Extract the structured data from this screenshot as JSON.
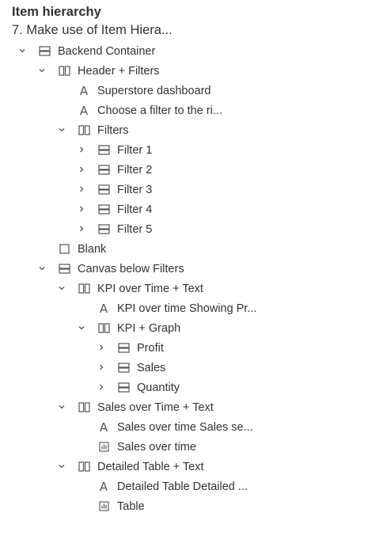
{
  "panel": {
    "title": "Item hierarchy",
    "dashboard_name": "7. Make use of Item Hiera..."
  },
  "tree": [
    {
      "label": "Backend Container",
      "type": "vertical",
      "toggle": "expanded"
    },
    {
      "label": "Header + Filters",
      "type": "horizontal",
      "toggle": "expanded"
    },
    {
      "label": "Superstore dashboard",
      "type": "text",
      "toggle": "none"
    },
    {
      "label": "Choose a filter to the ri...",
      "type": "text",
      "toggle": "none"
    },
    {
      "label": "Filters",
      "type": "horizontal",
      "toggle": "expanded"
    },
    {
      "label": "Filter 1",
      "type": "vertical",
      "toggle": "collapsed"
    },
    {
      "label": "Filter 2",
      "type": "vertical",
      "toggle": "collapsed"
    },
    {
      "label": "Filter 3",
      "type": "vertical",
      "toggle": "collapsed"
    },
    {
      "label": "Filter 4",
      "type": "vertical",
      "toggle": "collapsed"
    },
    {
      "label": "Filter 5",
      "type": "vertical",
      "toggle": "collapsed"
    },
    {
      "label": "Blank",
      "type": "blank",
      "toggle": "none"
    },
    {
      "label": "Canvas below Filters",
      "type": "vertical",
      "toggle": "expanded"
    },
    {
      "label": "KPI over Time + Text",
      "type": "horizontal",
      "toggle": "expanded"
    },
    {
      "label": "KPI over time  Showing Pr...",
      "type": "text",
      "toggle": "none"
    },
    {
      "label": "KPI + Graph",
      "type": "horizontal",
      "toggle": "expanded"
    },
    {
      "label": "Profit",
      "type": "vertical",
      "toggle": "collapsed"
    },
    {
      "label": "Sales",
      "type": "vertical",
      "toggle": "collapsed"
    },
    {
      "label": "Quantity",
      "type": "vertical",
      "toggle": "collapsed"
    },
    {
      "label": "Sales over Time + Text",
      "type": "horizontal",
      "toggle": "expanded"
    },
    {
      "label": "Sales over time  Sales se...",
      "type": "text",
      "toggle": "none"
    },
    {
      "label": "Sales over time",
      "type": "sheet",
      "toggle": "none"
    },
    {
      "label": "Detailed Table + Text",
      "type": "horizontal",
      "toggle": "expanded"
    },
    {
      "label": "Detailed Table  Detailed ...",
      "type": "text",
      "toggle": "none"
    },
    {
      "label": "Table",
      "type": "sheet",
      "toggle": "none"
    }
  ],
  "icons": {
    "vertical": "vertical-container-icon",
    "horizontal": "horizontal-container-icon",
    "text": "text-object-icon",
    "blank": "blank-object-icon",
    "sheet": "worksheet-icon",
    "expanded": "chevron-down-icon",
    "collapsed": "chevron-right-icon"
  },
  "colors": {
    "text": "#333333",
    "icon": "#555555",
    "background": "#ffffff"
  }
}
